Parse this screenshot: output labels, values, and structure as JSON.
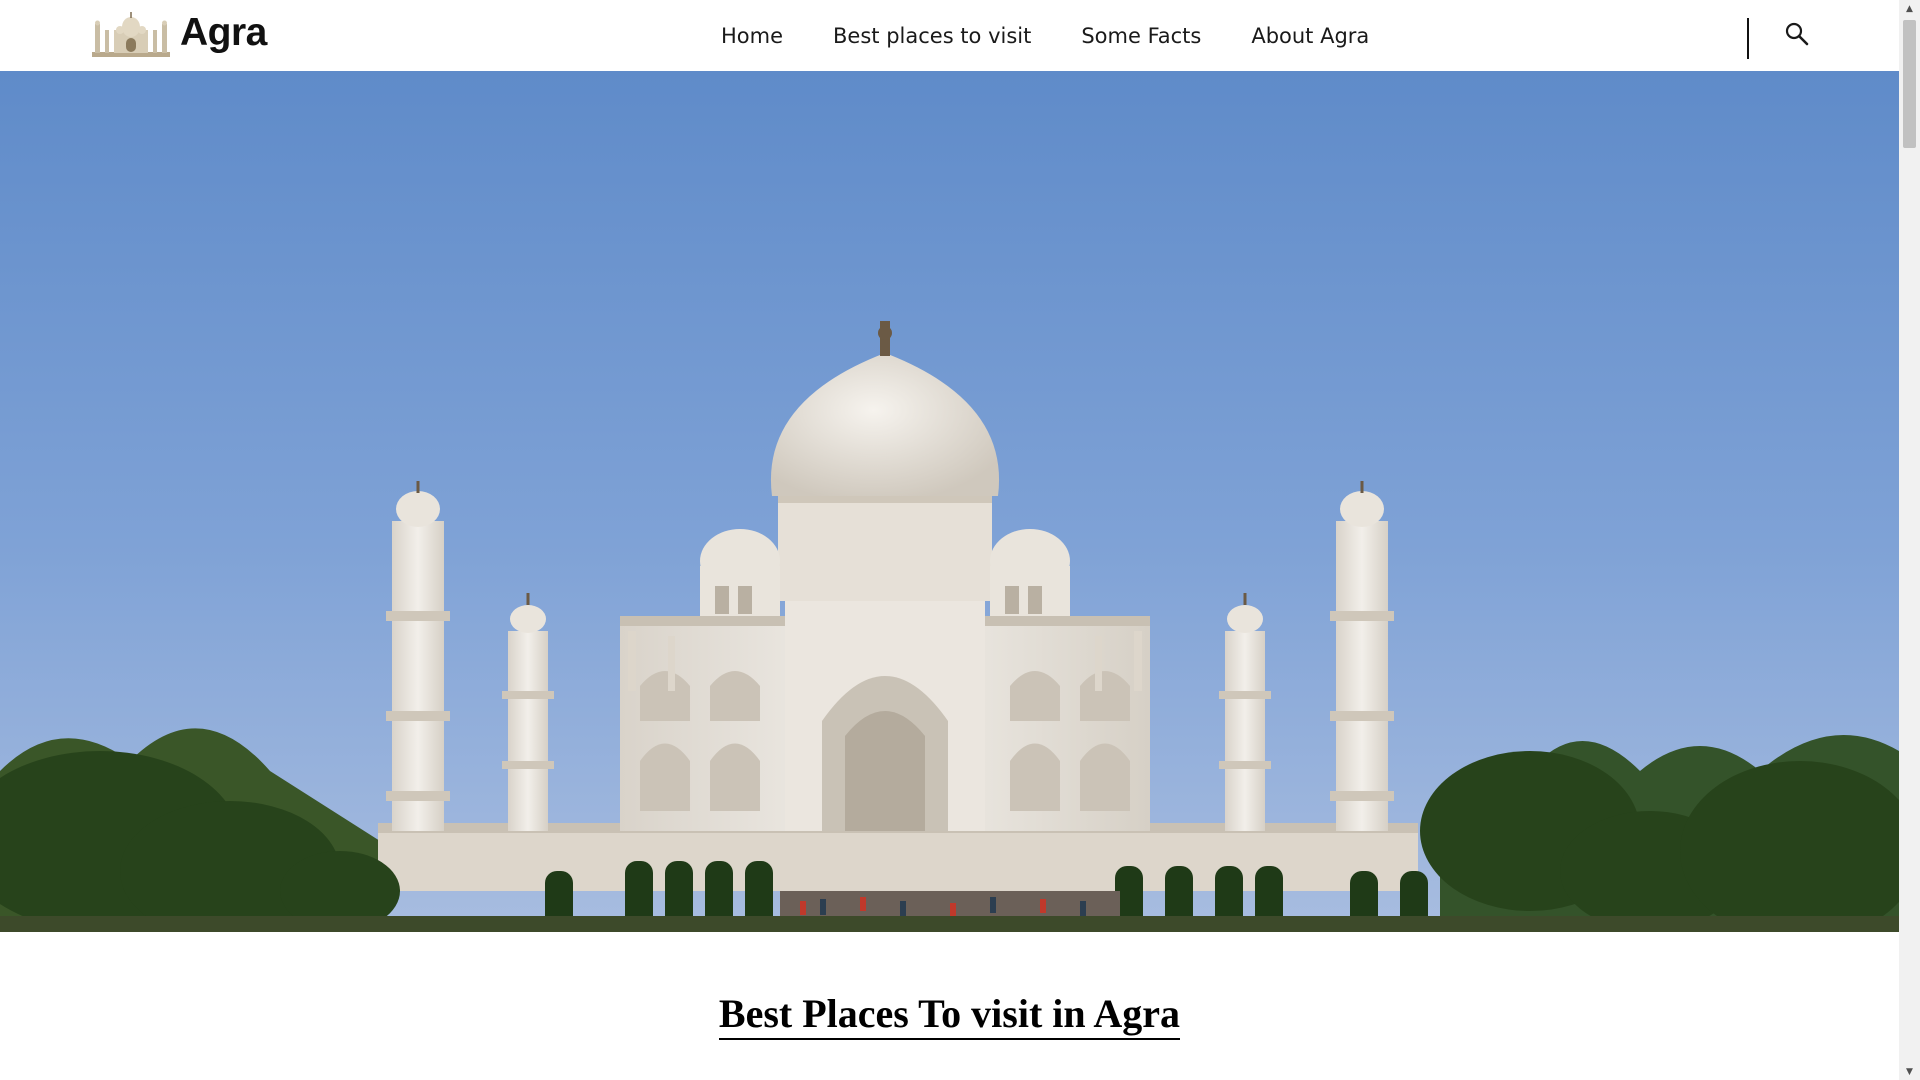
{
  "brand": {
    "name": "Agra",
    "logo_icon": "taj-mahal-logo-icon"
  },
  "nav": {
    "links": [
      {
        "label": "Home"
      },
      {
        "label": "Best places to visit"
      },
      {
        "label": "Some Facts"
      },
      {
        "label": "About Agra"
      }
    ],
    "search_icon": "search-icon"
  },
  "hero": {
    "image_subject": "taj-mahal-photo"
  },
  "section": {
    "heading": "Best Places To visit in Agra"
  },
  "colors": {
    "sky": "#6b96cf",
    "marble": "#ece8e2",
    "foliage": "#2d4a1f",
    "text": "#111111"
  }
}
